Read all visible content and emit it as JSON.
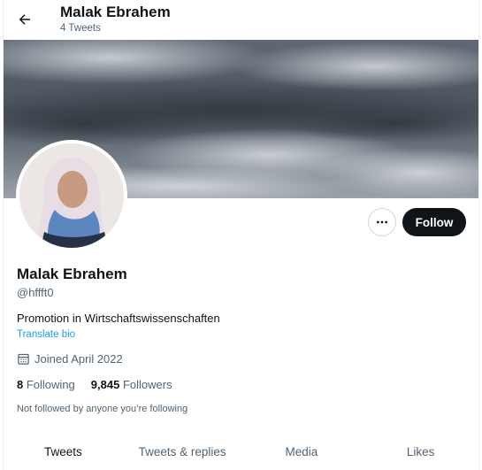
{
  "header": {
    "title": "Malak Ebrahem",
    "subtitle": "4 Tweets"
  },
  "actions": {
    "more_icon": "more-horizontal-icon",
    "follow_label": "Follow"
  },
  "profile": {
    "name": "Malak Ebrahem",
    "handle": "@hffft0",
    "bio": "Promotion in Wirtschaftswissenschaften",
    "translate_label": "Translate bio",
    "joined": "Joined April 2022",
    "following_count": "8",
    "following_label": "Following",
    "followers_count": "9,845",
    "followers_label": "Followers",
    "not_followed_text": "Not followed by anyone you’re following"
  },
  "tabs": [
    {
      "label": "Tweets",
      "active": true
    },
    {
      "label": "Tweets & replies",
      "active": false
    },
    {
      "label": "Media",
      "active": false
    },
    {
      "label": "Likes",
      "active": false
    }
  ],
  "colors": {
    "text": "#0f1419",
    "secondary": "#536471",
    "link": "#1d9bf0",
    "follow_bg": "#0f1419"
  }
}
